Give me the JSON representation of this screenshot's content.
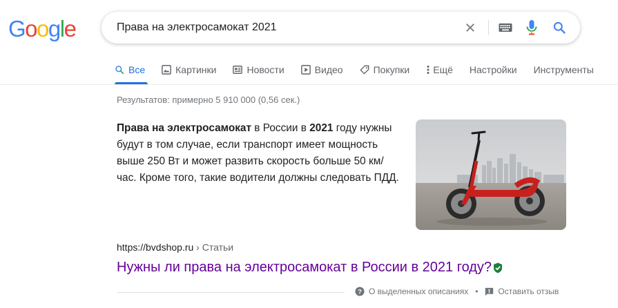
{
  "logo": {
    "letters": [
      "G",
      "o",
      "o",
      "g",
      "l",
      "e"
    ],
    "colors": [
      "#4285F4",
      "#EA4335",
      "#FBBC05",
      "#4285F4",
      "#34A853",
      "#EA4335"
    ]
  },
  "search": {
    "query": "Права на электросамокат 2021",
    "icons": [
      "close-icon",
      "keyboard-icon",
      "microphone-icon",
      "search-icon"
    ]
  },
  "tabs": [
    {
      "label": "Все",
      "icon": "search-icon",
      "active": true
    },
    {
      "label": "Картинки",
      "icon": "image-icon"
    },
    {
      "label": "Новости",
      "icon": "news-icon"
    },
    {
      "label": "Видео",
      "icon": "video-icon"
    },
    {
      "label": "Покупки",
      "icon": "tag-icon"
    },
    {
      "label": "Ещё",
      "icon": "more-vert-icon"
    },
    {
      "label": "Настройки"
    },
    {
      "label": "Инструменты"
    }
  ],
  "stats": "Результатов: примерно 5 910 000 (0,56 сек.)",
  "snippet": {
    "part1_bold": "Права на электросамокат",
    "part2": " в России в ",
    "part3_bold": "2021",
    "part4": " году нужны будут в том случае, если транспорт имеет мощность выше 250 Вт и может развить скорость больше 50 км/час. Кроме того, такие водители должны следовать ПДД."
  },
  "result": {
    "url": "https://bvdshop.ru",
    "breadcrumb": " › Статьи",
    "title": "Нужны ли права на электросамокат в России в 2021 году?"
  },
  "footer": {
    "about": "О выделенных описаниях",
    "separator": "•",
    "feedback": "Оставить отзыв"
  },
  "colors": {
    "accent": "#1a73e8",
    "visited_link": "#660099",
    "verified_badge": "#188038"
  }
}
